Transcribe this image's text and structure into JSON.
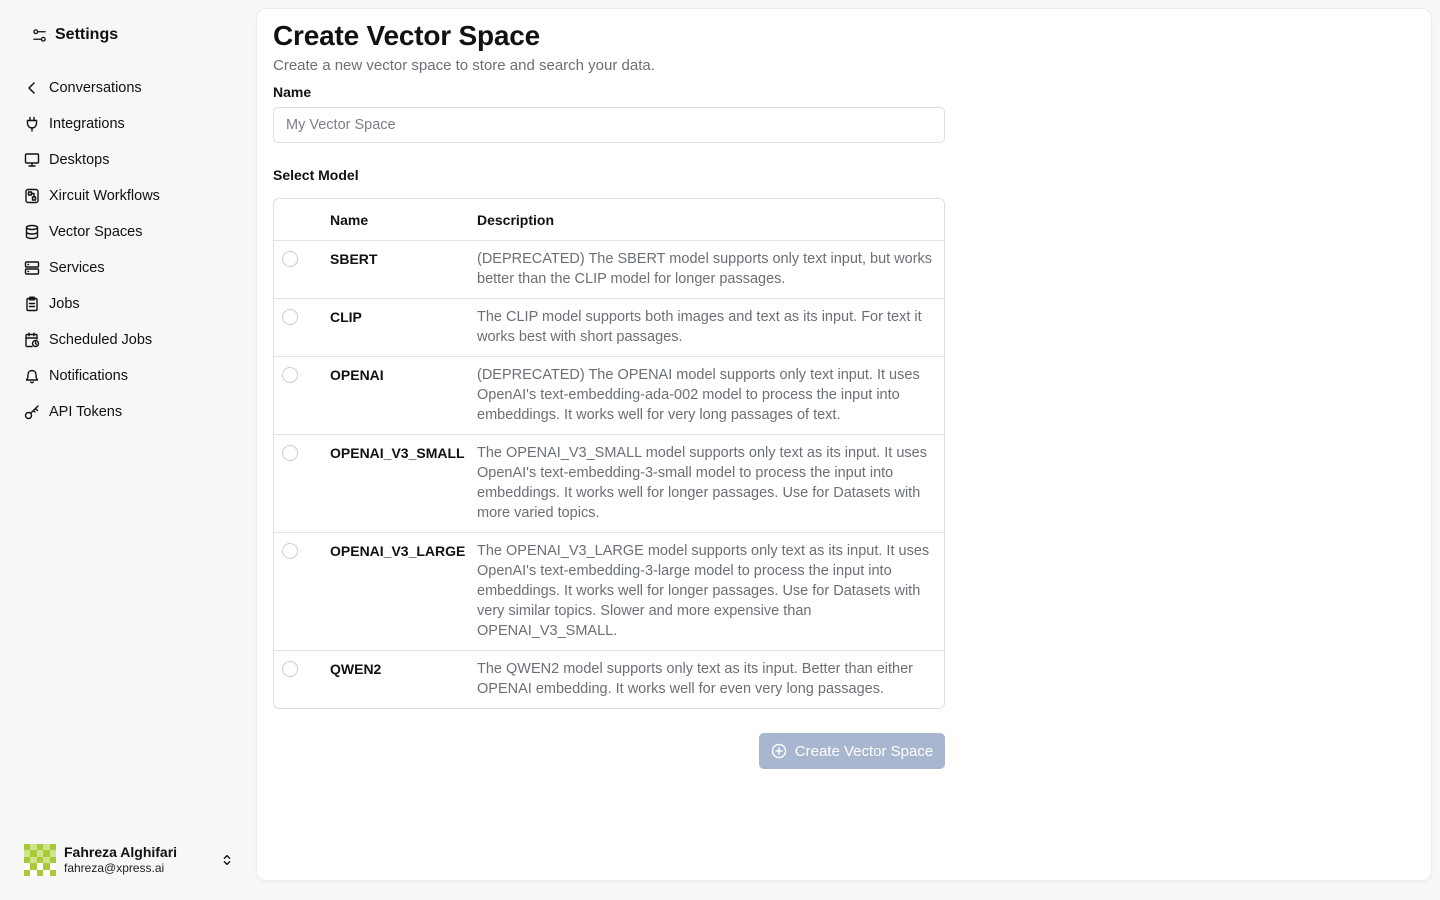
{
  "sidebar": {
    "title": "Settings",
    "items": [
      {
        "label": "Conversations",
        "icon": "chevron-left-icon"
      },
      {
        "label": "Integrations",
        "icon": "plug-icon"
      },
      {
        "label": "Desktops",
        "icon": "monitor-icon"
      },
      {
        "label": "Xircuit Workflows",
        "icon": "workflow-icon"
      },
      {
        "label": "Vector Spaces",
        "icon": "database-icon"
      },
      {
        "label": "Services",
        "icon": "server-icon"
      },
      {
        "label": "Jobs",
        "icon": "clipboard-icon"
      },
      {
        "label": "Scheduled Jobs",
        "icon": "calendar-clock-icon"
      },
      {
        "label": "Notifications",
        "icon": "bell-icon"
      },
      {
        "label": "API Tokens",
        "icon": "key-icon"
      }
    ],
    "user": {
      "name": "Fahreza Alghifari",
      "email": "fahreza@xpress.ai"
    }
  },
  "main": {
    "title": "Create Vector Space",
    "subtitle": "Create a new vector space to store and search your data.",
    "name_label": "Name",
    "name_placeholder": "My Vector Space",
    "model_label": "Select Model",
    "table": {
      "headers": {
        "name": "Name",
        "description": "Description"
      },
      "rows": [
        {
          "name": "SBERT",
          "description": "(DEPRECATED) The SBERT model supports only text input, but works better than the CLIP model for longer passages."
        },
        {
          "name": "CLIP",
          "description": "The CLIP model supports both images and text as its input. For text it works best with short passages."
        },
        {
          "name": "OPENAI",
          "description": "(DEPRECATED) The OPENAI model supports only text input. It uses OpenAI's text-embedding-ada-002 model to process the input into embeddings. It works well for very long passages of text."
        },
        {
          "name": "OPENAI_V3_SMALL",
          "description": "The OPENAI_V3_SMALL model supports only text as its input. It uses OpenAI's text-embedding-3-small model to process the input into embeddings. It works well for longer passages. Use for Datasets with more varied topics."
        },
        {
          "name": "OPENAI_V3_LARGE",
          "description": "The OPENAI_V3_LARGE model supports only text as its input. It uses OpenAI's text-embedding-3-large model to process the input into embeddings. It works well for longer passages. Use for Datasets with very similar topics. Slower and more expensive than OPENAI_V3_SMALL."
        },
        {
          "name": "QWEN2",
          "description": "The QWEN2 model supports only text as its input. Better than either OPENAI embedding. It works well for even very long passages."
        }
      ]
    },
    "create_button_label": "Create Vector Space",
    "create_button_color": "#a8b7cf"
  }
}
